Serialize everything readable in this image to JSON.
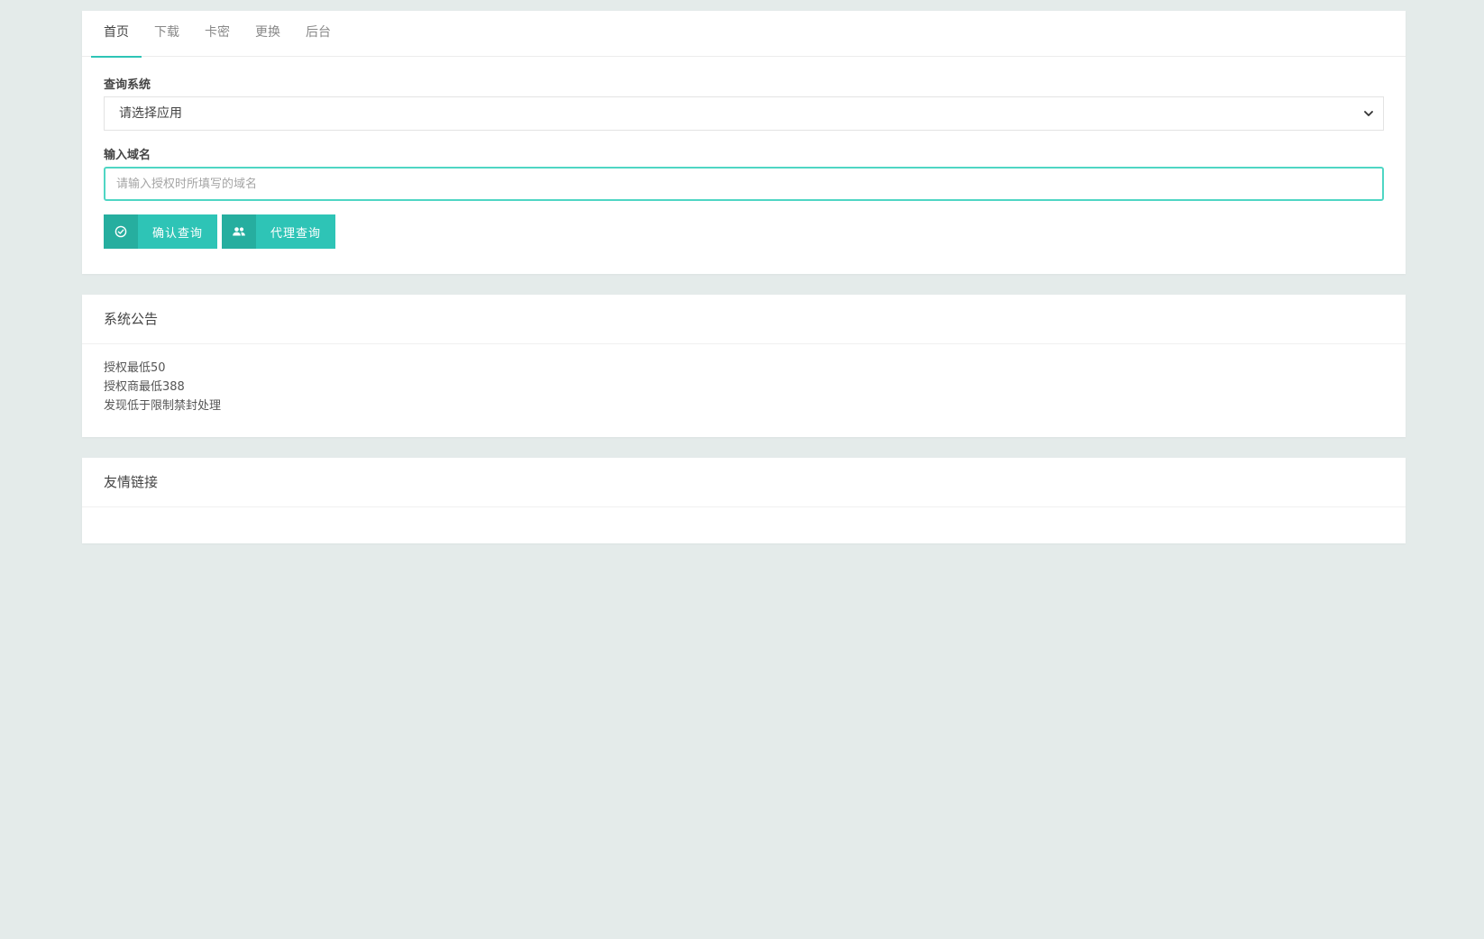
{
  "nav": {
    "tabs": [
      {
        "label": "首页",
        "active": true
      },
      {
        "label": "下载",
        "active": false
      },
      {
        "label": "卡密",
        "active": false
      },
      {
        "label": "更换",
        "active": false
      },
      {
        "label": "后台",
        "active": false
      }
    ]
  },
  "query_form": {
    "system_label": "查询系统",
    "system_select_value": "请选择应用",
    "domain_label": "输入域名",
    "domain_placeholder": "请输入授权时所填写的域名",
    "domain_value": "",
    "confirm_button": "确认查询",
    "agent_button": "代理查询"
  },
  "notice": {
    "title": "系统公告",
    "lines": [
      "授权最低50",
      "授权商最低388",
      "发现低于限制禁封处理"
    ]
  },
  "links": {
    "title": "友情链接"
  },
  "colors": {
    "accent": "#2ec4b6",
    "accent_dark": "#26ae9f",
    "background": "#e4ebea"
  },
  "icons": {
    "confirm": "check-circle-icon",
    "agent": "users-icon",
    "select": "chevron-down-icon"
  }
}
